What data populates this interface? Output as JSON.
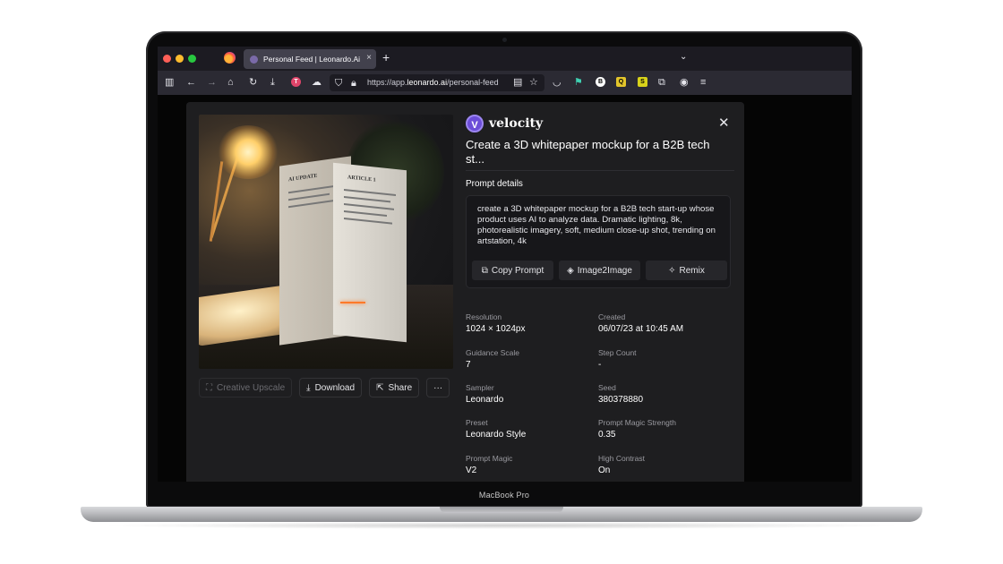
{
  "device": {
    "label": "MacBook Pro"
  },
  "browser": {
    "tab_title": "Personal Feed | Leonardo.Ai",
    "tab_close": "×",
    "new_tab": "+",
    "tab_list": "⌄",
    "url_prefix": "https://app.",
    "url_domain": "leonardo.ai",
    "url_path": "/personal-feed",
    "icons": [
      "sidebar-icon",
      "back-icon",
      "forward-icon",
      "home-icon",
      "reload-icon",
      "download-icon",
      "extension-t-icon",
      "cloud-icon",
      "shield-icon",
      "lock-icon",
      "reader-icon",
      "star-icon",
      "pocket-icon",
      "extension-icon",
      "extension-b-icon",
      "extension-q-icon",
      "extension-s-icon",
      "puzzle-icon",
      "account-icon",
      "menu-icon"
    ]
  },
  "image": {
    "book_title": "AI UPDATE",
    "book_subtitle": "ARTICLE 1"
  },
  "actions": {
    "creative_upscale": "Creative Upscale",
    "download": "Download",
    "share": "Share",
    "more": "···"
  },
  "modal": {
    "brand": "velocity",
    "brand_initial": "V",
    "close": "✕",
    "title": "Create a 3D whitepaper mockup for a B2B tech st...",
    "prompt_details_label": "Prompt details",
    "prompt": "create a 3D whitepaper mockup for a B2B tech start-up whose product uses AI to analyze data. Dramatic lighting, 8k, photorealistic imagery, soft, medium close-up shot, trending on artstation, 4k",
    "copy_prompt": "Copy Prompt",
    "image2image": "Image2Image",
    "remix": "Remix"
  },
  "meta": [
    {
      "key": "Resolution",
      "value": "1024 × 1024px"
    },
    {
      "key": "Created",
      "value": "06/07/23 at 10:45 AM"
    },
    {
      "key": "Guidance Scale",
      "value": "7"
    },
    {
      "key": "Step Count",
      "value": "-"
    },
    {
      "key": "Sampler",
      "value": "Leonardo"
    },
    {
      "key": "Seed",
      "value": "380378880"
    },
    {
      "key": "Preset",
      "value": "Leonardo Style"
    },
    {
      "key": "Prompt Magic Strength",
      "value": "0.35"
    },
    {
      "key": "Prompt Magic",
      "value": "V2"
    },
    {
      "key": "High Contrast",
      "value": "On"
    }
  ],
  "colors": {
    "brand": "#6c4dd8",
    "modal_bg": "#1e1e20",
    "page_bg": "#050505"
  }
}
